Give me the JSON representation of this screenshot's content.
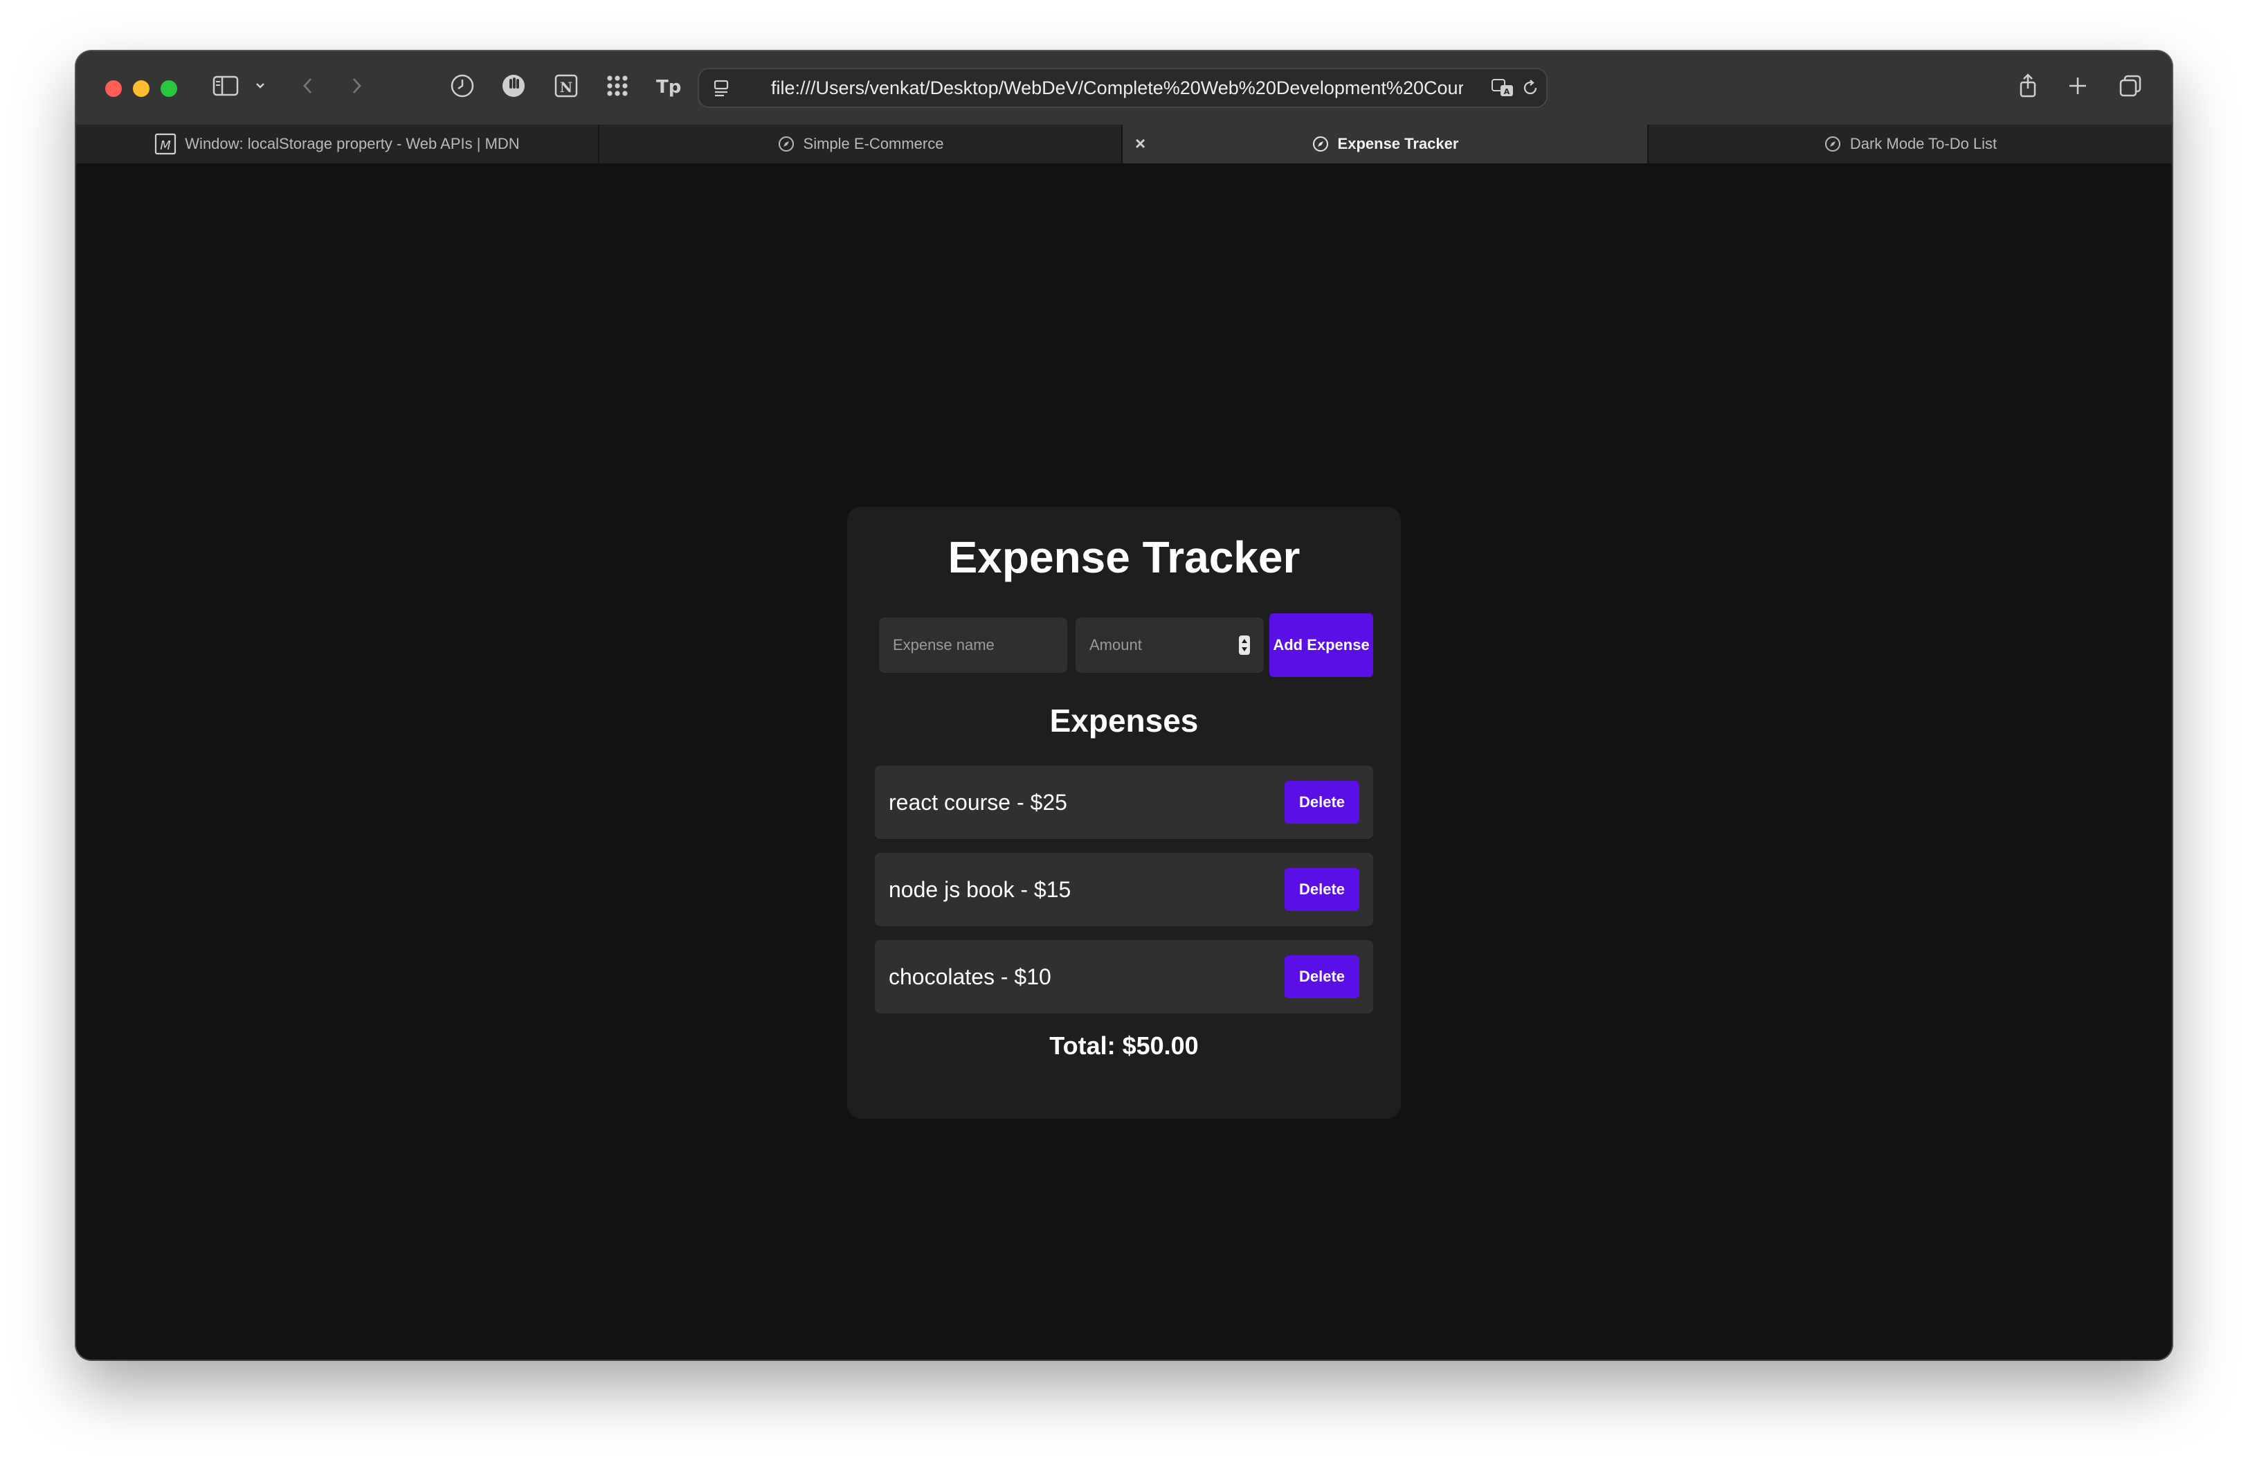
{
  "browser": {
    "url": "file:///Users/venkat/Desktop/WebDeV/Complete%20Web%20Development%20Cour",
    "tabs": [
      {
        "label": "Window: localStorage property - Web APIs | MDN",
        "active": false
      },
      {
        "label": "Simple E-Commerce",
        "active": false
      },
      {
        "label": "Expense Tracker",
        "active": true
      },
      {
        "label": "Dark Mode To-Do List",
        "active": false
      }
    ],
    "close_tab_glyph": "×"
  },
  "app": {
    "title": "Expense Tracker",
    "name_placeholder": "Expense name",
    "amount_placeholder": "Amount",
    "add_label": "Add Expense",
    "list_heading": "Expenses",
    "expenses": [
      {
        "text": "react course - $25",
        "delete_label": "Delete"
      },
      {
        "text": "node js book - $15",
        "delete_label": "Delete"
      },
      {
        "text": "chocolates - $10",
        "delete_label": "Delete"
      }
    ],
    "total": "Total: $50.00"
  },
  "colors": {
    "accent": "#5a0fe6",
    "page_background": "#121212",
    "card_background": "#1e1e1e"
  }
}
